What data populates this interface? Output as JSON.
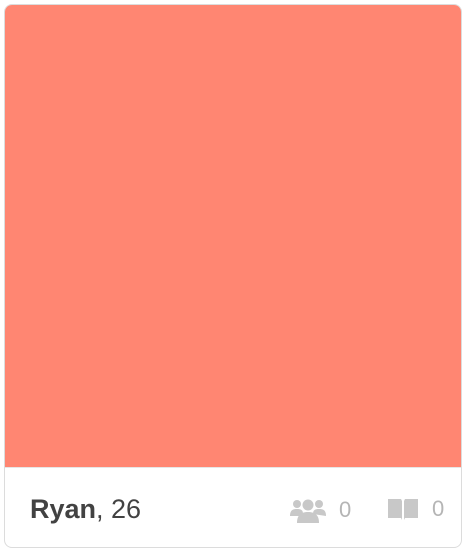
{
  "profile_card": {
    "photo_color": "#ff8672",
    "name": "Ryan",
    "age_suffix": ", 26",
    "shared_friends": {
      "icon": "friends-icon",
      "count": "0"
    },
    "shared_interests": {
      "icon": "book-icon",
      "count": "0"
    },
    "icon_color": "#c8c8c8"
  }
}
